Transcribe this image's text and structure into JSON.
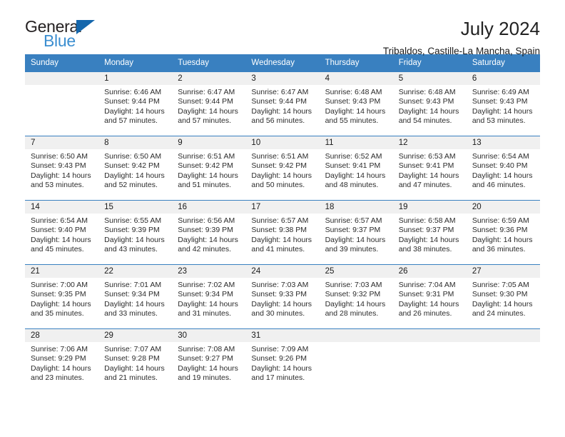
{
  "brand": {
    "name_top": "General",
    "name_bottom": "Blue",
    "accent_color": "#1567ac",
    "secondary_color": "#3b8ed0"
  },
  "header": {
    "title": "July 2024",
    "subtitle": "Tribaldos, Castille-La Mancha, Spain"
  },
  "theme": {
    "header_row_bg": "#3980c0",
    "daynum_bg": "#f0f0f0",
    "grid_line": "#3980c0"
  },
  "weekday_headers": [
    "Sunday",
    "Monday",
    "Tuesday",
    "Wednesday",
    "Thursday",
    "Friday",
    "Saturday"
  ],
  "labels": {
    "sunrise_prefix": "Sunrise:",
    "sunset_prefix": "Sunset:",
    "daylight_prefix": "Daylight:"
  },
  "weeks": [
    [
      {
        "empty": true
      },
      {
        "day": "1",
        "sunrise": "Sunrise: 6:46 AM",
        "sunset": "Sunset: 9:44 PM",
        "daylight": "Daylight: 14 hours and 57 minutes."
      },
      {
        "day": "2",
        "sunrise": "Sunrise: 6:47 AM",
        "sunset": "Sunset: 9:44 PM",
        "daylight": "Daylight: 14 hours and 57 minutes."
      },
      {
        "day": "3",
        "sunrise": "Sunrise: 6:47 AM",
        "sunset": "Sunset: 9:44 PM",
        "daylight": "Daylight: 14 hours and 56 minutes."
      },
      {
        "day": "4",
        "sunrise": "Sunrise: 6:48 AM",
        "sunset": "Sunset: 9:43 PM",
        "daylight": "Daylight: 14 hours and 55 minutes."
      },
      {
        "day": "5",
        "sunrise": "Sunrise: 6:48 AM",
        "sunset": "Sunset: 9:43 PM",
        "daylight": "Daylight: 14 hours and 54 minutes."
      },
      {
        "day": "6",
        "sunrise": "Sunrise: 6:49 AM",
        "sunset": "Sunset: 9:43 PM",
        "daylight": "Daylight: 14 hours and 53 minutes."
      }
    ],
    [
      {
        "day": "7",
        "sunrise": "Sunrise: 6:50 AM",
        "sunset": "Sunset: 9:43 PM",
        "daylight": "Daylight: 14 hours and 53 minutes."
      },
      {
        "day": "8",
        "sunrise": "Sunrise: 6:50 AM",
        "sunset": "Sunset: 9:42 PM",
        "daylight": "Daylight: 14 hours and 52 minutes."
      },
      {
        "day": "9",
        "sunrise": "Sunrise: 6:51 AM",
        "sunset": "Sunset: 9:42 PM",
        "daylight": "Daylight: 14 hours and 51 minutes."
      },
      {
        "day": "10",
        "sunrise": "Sunrise: 6:51 AM",
        "sunset": "Sunset: 9:42 PM",
        "daylight": "Daylight: 14 hours and 50 minutes."
      },
      {
        "day": "11",
        "sunrise": "Sunrise: 6:52 AM",
        "sunset": "Sunset: 9:41 PM",
        "daylight": "Daylight: 14 hours and 48 minutes."
      },
      {
        "day": "12",
        "sunrise": "Sunrise: 6:53 AM",
        "sunset": "Sunset: 9:41 PM",
        "daylight": "Daylight: 14 hours and 47 minutes."
      },
      {
        "day": "13",
        "sunrise": "Sunrise: 6:54 AM",
        "sunset": "Sunset: 9:40 PM",
        "daylight": "Daylight: 14 hours and 46 minutes."
      }
    ],
    [
      {
        "day": "14",
        "sunrise": "Sunrise: 6:54 AM",
        "sunset": "Sunset: 9:40 PM",
        "daylight": "Daylight: 14 hours and 45 minutes."
      },
      {
        "day": "15",
        "sunrise": "Sunrise: 6:55 AM",
        "sunset": "Sunset: 9:39 PM",
        "daylight": "Daylight: 14 hours and 43 minutes."
      },
      {
        "day": "16",
        "sunrise": "Sunrise: 6:56 AM",
        "sunset": "Sunset: 9:39 PM",
        "daylight": "Daylight: 14 hours and 42 minutes."
      },
      {
        "day": "17",
        "sunrise": "Sunrise: 6:57 AM",
        "sunset": "Sunset: 9:38 PM",
        "daylight": "Daylight: 14 hours and 41 minutes."
      },
      {
        "day": "18",
        "sunrise": "Sunrise: 6:57 AM",
        "sunset": "Sunset: 9:37 PM",
        "daylight": "Daylight: 14 hours and 39 minutes."
      },
      {
        "day": "19",
        "sunrise": "Sunrise: 6:58 AM",
        "sunset": "Sunset: 9:37 PM",
        "daylight": "Daylight: 14 hours and 38 minutes."
      },
      {
        "day": "20",
        "sunrise": "Sunrise: 6:59 AM",
        "sunset": "Sunset: 9:36 PM",
        "daylight": "Daylight: 14 hours and 36 minutes."
      }
    ],
    [
      {
        "day": "21",
        "sunrise": "Sunrise: 7:00 AM",
        "sunset": "Sunset: 9:35 PM",
        "daylight": "Daylight: 14 hours and 35 minutes."
      },
      {
        "day": "22",
        "sunrise": "Sunrise: 7:01 AM",
        "sunset": "Sunset: 9:34 PM",
        "daylight": "Daylight: 14 hours and 33 minutes."
      },
      {
        "day": "23",
        "sunrise": "Sunrise: 7:02 AM",
        "sunset": "Sunset: 9:34 PM",
        "daylight": "Daylight: 14 hours and 31 minutes."
      },
      {
        "day": "24",
        "sunrise": "Sunrise: 7:03 AM",
        "sunset": "Sunset: 9:33 PM",
        "daylight": "Daylight: 14 hours and 30 minutes."
      },
      {
        "day": "25",
        "sunrise": "Sunrise: 7:03 AM",
        "sunset": "Sunset: 9:32 PM",
        "daylight": "Daylight: 14 hours and 28 minutes."
      },
      {
        "day": "26",
        "sunrise": "Sunrise: 7:04 AM",
        "sunset": "Sunset: 9:31 PM",
        "daylight": "Daylight: 14 hours and 26 minutes."
      },
      {
        "day": "27",
        "sunrise": "Sunrise: 7:05 AM",
        "sunset": "Sunset: 9:30 PM",
        "daylight": "Daylight: 14 hours and 24 minutes."
      }
    ],
    [
      {
        "day": "28",
        "sunrise": "Sunrise: 7:06 AM",
        "sunset": "Sunset: 9:29 PM",
        "daylight": "Daylight: 14 hours and 23 minutes."
      },
      {
        "day": "29",
        "sunrise": "Sunrise: 7:07 AM",
        "sunset": "Sunset: 9:28 PM",
        "daylight": "Daylight: 14 hours and 21 minutes."
      },
      {
        "day": "30",
        "sunrise": "Sunrise: 7:08 AM",
        "sunset": "Sunset: 9:27 PM",
        "daylight": "Daylight: 14 hours and 19 minutes."
      },
      {
        "day": "31",
        "sunrise": "Sunrise: 7:09 AM",
        "sunset": "Sunset: 9:26 PM",
        "daylight": "Daylight: 14 hours and 17 minutes."
      },
      {
        "empty": true
      },
      {
        "empty": true
      },
      {
        "empty": true
      }
    ]
  ]
}
